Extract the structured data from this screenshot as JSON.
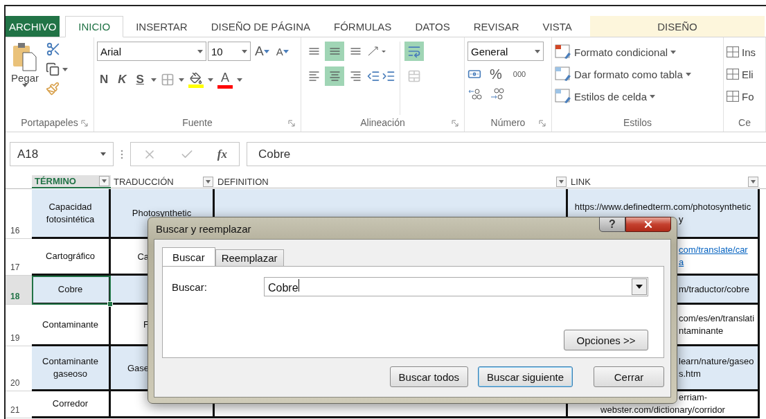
{
  "ribbon_tabs": [
    {
      "label": "ARCHIVO",
      "kind": "file",
      "selected": false
    },
    {
      "label": "INICIO",
      "kind": "tab",
      "selected": true
    },
    {
      "label": "INSERTAR",
      "kind": "tab",
      "selected": false
    },
    {
      "label": "DISEÑO DE PÁGINA",
      "kind": "tab",
      "selected": false
    },
    {
      "label": "FÓRMULAS",
      "kind": "tab",
      "selected": false
    },
    {
      "label": "DATOS",
      "kind": "tab",
      "selected": false
    },
    {
      "label": "REVISAR",
      "kind": "tab",
      "selected": false
    },
    {
      "label": "VISTA",
      "kind": "tab",
      "selected": false
    },
    {
      "label": "DISEÑO",
      "kind": "contextual",
      "selected": false
    }
  ],
  "ribbon": {
    "clipboard": {
      "paste_label": "Pegar",
      "group_label": "Portapapeles"
    },
    "font": {
      "name": "Arial",
      "size": "10",
      "grow_label": "A",
      "shrink_label": "A",
      "bold_label": "N",
      "italic_label": "K",
      "underline_label": "S",
      "font_color_label": "A",
      "group_label": "Fuente"
    },
    "alignment": {
      "buttons": [
        {
          "kind": "top",
          "selected": false
        },
        {
          "kind": "middle",
          "selected": true
        },
        {
          "kind": "bottom",
          "selected": false
        },
        {
          "kind": "left",
          "selected": false
        },
        {
          "kind": "center",
          "selected": true
        },
        {
          "kind": "right",
          "selected": false
        }
      ],
      "wrap": {
        "selected": true
      },
      "merge": {
        "disabled": true
      },
      "group_label": "Alineación"
    },
    "number": {
      "format": "General",
      "percent_label": "%",
      "thousands_label": "000",
      "group_label": "Número"
    },
    "styles": {
      "items": [
        "Formato condicional",
        "Dar formato como tabla",
        "Estilos de celda"
      ],
      "group_label": "Estilos"
    },
    "cells": {
      "items": [
        "Ins",
        "Eli",
        "Fo"
      ],
      "group_label": "Ce"
    }
  },
  "formula_bar": {
    "name_box": "A18",
    "function_label": "fx",
    "value": "Cobre"
  },
  "table": {
    "columns": [
      {
        "label": "TÉRMINO",
        "selected": true
      },
      {
        "label": "TRADUCCIÓN",
        "selected": false
      },
      {
        "label": "DEFINITION",
        "selected": false
      },
      {
        "label": "LINK",
        "selected": false
      }
    ],
    "rows": [
      {
        "number": "16",
        "selected": false,
        "banded": true,
        "term": "Capacidad fotosintética",
        "translation": {
          "text": "Photosynthetic",
          "covered": false
        },
        "link": {
          "hyperlink": false,
          "lines": [
            {
              "text": "https://www.definedterm.com/photosynthetic",
              "covered": false
            },
            {
              "text": "y",
              "covered": true
            }
          ]
        }
      },
      {
        "number": "17",
        "selected": false,
        "banded": false,
        "term": "Cartográfico",
        "translation": {
          "text": "Ca",
          "covered": true
        },
        "link": {
          "hyperlink": true,
          "lines": [
            {
              "text": "com/translate/car",
              "covered": true
            },
            {
              "text": "a",
              "covered": true
            }
          ]
        }
      },
      {
        "number": "18",
        "selected": true,
        "banded": true,
        "term": "Cobre",
        "link": {
          "hyperlink": false,
          "lines": [
            {
              "text": "m/traductor/cobre",
              "covered": true
            }
          ]
        }
      },
      {
        "number": "19",
        "selected": false,
        "banded": false,
        "term": "Contaminante",
        "translation": {
          "text": "F",
          "covered": true
        },
        "link": {
          "hyperlink": false,
          "lines": [
            {
              "text": "com/es/en/translati",
              "covered": true
            },
            {
              "text": "ntaminante",
              "covered": true
            }
          ]
        }
      },
      {
        "number": "20",
        "selected": false,
        "banded": true,
        "term": "Contaminante gaseoso",
        "translation": {
          "text": "Gase",
          "covered": true
        },
        "link": {
          "hyperlink": false,
          "lines": [
            {
              "text": "learn/nature/gaseo",
              "covered": true
            },
            {
              "text": "s.htm",
              "covered": true
            }
          ]
        }
      },
      {
        "number": "21",
        "selected": false,
        "banded": false,
        "term": "Corredor",
        "link": {
          "hyperlink": false,
          "lines": [
            {
              "text": "erriam-",
              "covered": true
            },
            {
              "text": "webster.com/dictionary/corridor",
              "covered": false
            }
          ]
        }
      }
    ]
  },
  "dialog": {
    "title": "Buscar y reemplazar",
    "help_label": "?",
    "tabs": [
      {
        "label": "Buscar",
        "selected": true
      },
      {
        "label": "Reemplazar",
        "selected": false
      }
    ],
    "find_label": "Buscar:",
    "find_value": "Cobre",
    "options_label": "Opciones >>",
    "buttons": [
      {
        "label": "Buscar todos",
        "default": false
      },
      {
        "label": "Buscar siguiente",
        "default": true
      },
      {
        "label": "Cerrar",
        "default": false
      }
    ]
  }
}
